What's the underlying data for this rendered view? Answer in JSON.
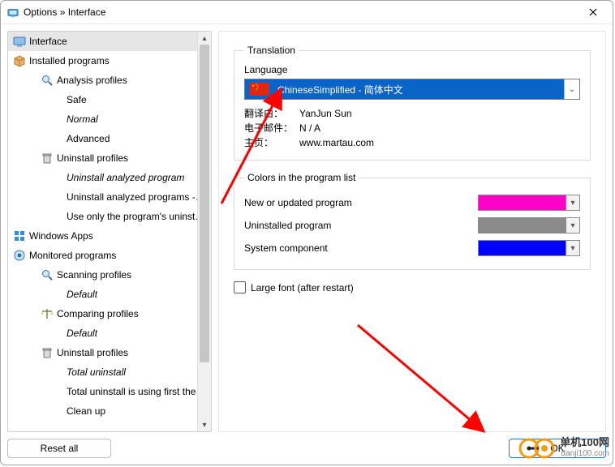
{
  "window": {
    "title": "Options » Interface"
  },
  "sidebar": {
    "reset_label": "Reset all",
    "nodes": {
      "interface": "Interface",
      "installed_programs": "Installed programs",
      "analysis_profiles": "Analysis profiles",
      "safe": "Safe",
      "normal": "Normal",
      "advanced": "Advanced",
      "uninstall_profiles": "Uninstall profiles",
      "uap": "Uninstall analyzed program",
      "uaps": "Uninstall analyzed programs - ...",
      "useonly": "Use only the program's uninsta...",
      "windows_apps": "Windows Apps",
      "monitored_programs": "Monitored programs",
      "scanning_profiles": "Scanning profiles",
      "scanning_default": "Default",
      "comparing_profiles": "Comparing profiles",
      "comparing_default": "Default",
      "mon_uninstall_profiles": "Uninstall profiles",
      "total_uninstall": "Total uninstall",
      "total_uninstall_first": "Total uninstall is using first the ...",
      "clean_up": "Clean up"
    }
  },
  "translation": {
    "group_label": "Translation",
    "language_label": "Language",
    "selected": "ChineseSimplified - 简体中文",
    "credits": {
      "by_label": "翻译由：",
      "by_value": "YanJun Sun",
      "email_label": "电子邮件：",
      "email_value": "N / A",
      "home_label": "主页：",
      "home_value": "www.martau.com"
    }
  },
  "colors": {
    "group_label": "Colors in the program list",
    "rows": {
      "new_or_updated": "New or updated program",
      "uninstalled": "Uninstalled program",
      "system": "System component"
    },
    "swatches": {
      "new_or_updated": "#ff00c8",
      "uninstalled": "#8a8a8a",
      "system": "#0000ff"
    }
  },
  "large_font": {
    "label": "Large font (after restart)",
    "checked": false
  },
  "footer": {
    "ok_label": "OK"
  },
  "watermark": {
    "line1": "单机100网",
    "line2": "danji100.com"
  }
}
